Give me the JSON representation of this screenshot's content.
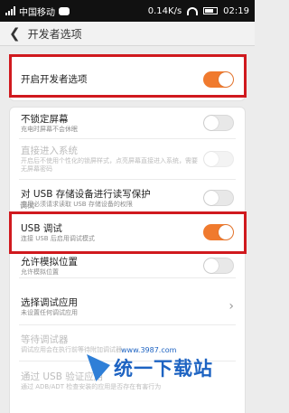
{
  "status_bar": {
    "carrier": "中国移动",
    "speed": "0.14K/s",
    "time": "02:19"
  },
  "header": {
    "title": "开发者选项"
  },
  "dev_options": {
    "label": "开启开发者选项",
    "on": true
  },
  "settings": [
    {
      "label": "不锁定屏幕",
      "sub": "充电时屏幕不会休眠",
      "on": false,
      "dim": false
    },
    {
      "label": "直接进入系统",
      "sub": "开启后不使用个性化的锁屏样式，点亮屏幕直接进入系统，需要无屏幕密码",
      "on": false,
      "dim": true
    },
    {
      "label": "对 USB 存储设备进行读写保护",
      "sub": "应用必须请求读取 USB 存储设备的权限",
      "on": false,
      "dim": false
    }
  ],
  "section_label": "调试",
  "debug": [
    {
      "label": "USB 调试",
      "sub": "连接 USB 后启用调试模式",
      "on": true
    },
    {
      "label": "允许模拟位置",
      "sub": "允许模拟位置",
      "on": false
    },
    {
      "label": "选择调试应用",
      "sub": "未设置任何调试应用"
    },
    {
      "label": "等待调试器",
      "sub": "调试应用会在执行前等待附加调试器"
    },
    {
      "label": "通过 USB 验证应用",
      "sub": "通过 ADB/ADT 检查安装的应用是否存在有害行为"
    }
  ],
  "watermark": {
    "text": "统一下载站",
    "url": "www.3987.com"
  },
  "colors": {
    "accent": "#f07a2e",
    "highlight": "#d0191e"
  }
}
